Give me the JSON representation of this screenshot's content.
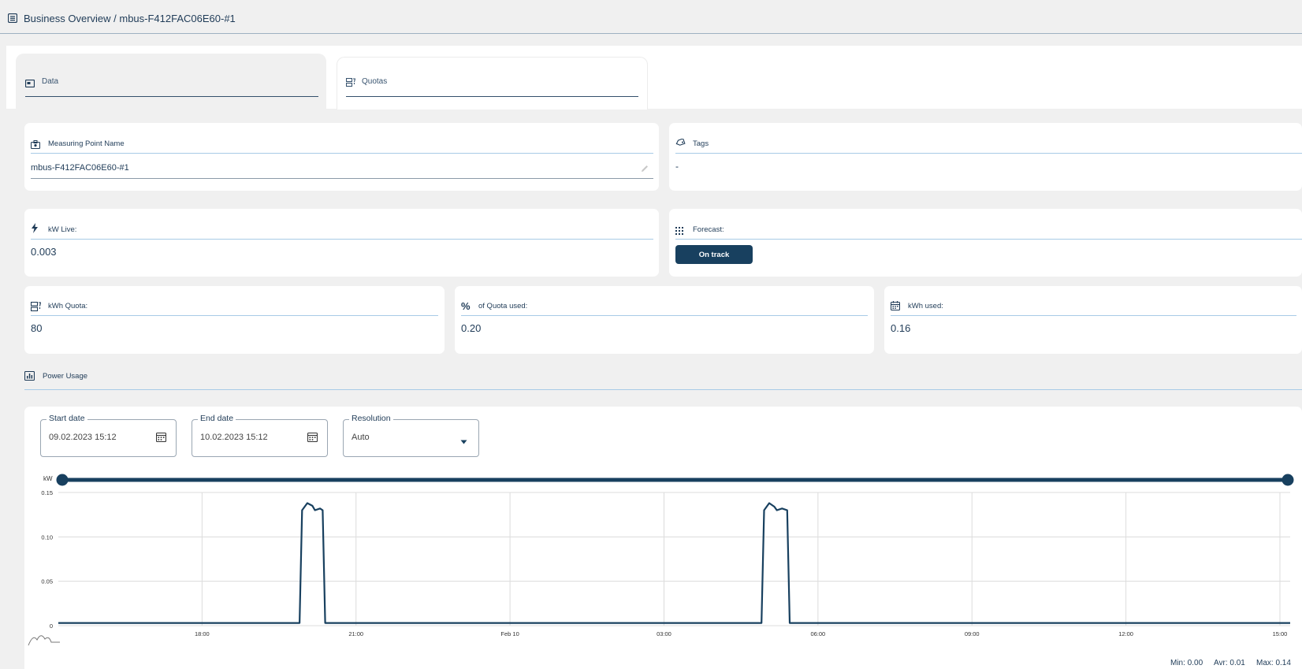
{
  "header": {
    "title": "Business Overview / mbus-F412FAC06E60-#1"
  },
  "tabs": [
    {
      "label": "Data",
      "icon": "card-icon",
      "active": true
    },
    {
      "label": "Quotas",
      "icon": "quota-icon",
      "active": false
    }
  ],
  "measuring_point": {
    "label": "Measuring Point Name",
    "value": "mbus-F412FAC06E60-#1"
  },
  "tags": {
    "label": "Tags",
    "value": "-"
  },
  "kw_live": {
    "label": "kW Live:",
    "value": "0.003"
  },
  "forecast": {
    "label": "Forecast:",
    "button": "On track"
  },
  "kwh_quota": {
    "label": "kWh Quota:",
    "value": "80"
  },
  "quota_used": {
    "label": "of Quota used:",
    "symbol": "%",
    "value": "0.20"
  },
  "kwh_used": {
    "label": "kWh used:",
    "value": "0.16"
  },
  "power_usage": {
    "label": "Power Usage"
  },
  "filters": {
    "start_date": {
      "legend": "Start date",
      "value": "09.02.2023 15:12"
    },
    "end_date": {
      "legend": "End date",
      "value": "10.02.2023 15:12"
    },
    "resolution": {
      "legend": "Resolution",
      "value": "Auto"
    }
  },
  "stats": {
    "min": "Min: 0.00",
    "avg": "Avr: 0.01",
    "max": "Max: 0.14"
  },
  "colors": {
    "primary": "#18405f",
    "rule": "#a8cbe6",
    "background": "#f0f0f0"
  },
  "chart_data": {
    "type": "line",
    "ylabel": "kW",
    "ylim": [
      0,
      0.15
    ],
    "yticks": [
      {
        "v": 0,
        "label": "0"
      },
      {
        "v": 0.05,
        "label": "0.05"
      },
      {
        "v": 0.1,
        "label": "0.10"
      },
      {
        "v": 0.15,
        "label": "0.15"
      }
    ],
    "xlim": [
      15.2,
      39.2
    ],
    "xticks": [
      {
        "h": 18,
        "label": "18:00"
      },
      {
        "h": 21,
        "label": "21:00"
      },
      {
        "h": 24,
        "label": "Feb 10"
      },
      {
        "h": 27,
        "label": "03:00"
      },
      {
        "h": 30,
        "label": "06:00"
      },
      {
        "h": 33,
        "label": "09:00"
      },
      {
        "h": 36,
        "label": "12:00"
      },
      {
        "h": 39,
        "label": "15:00"
      }
    ],
    "series": [
      {
        "points": [
          [
            15.2,
            0.003
          ],
          [
            19.9,
            0.003
          ],
          [
            19.95,
            0.13
          ],
          [
            20.05,
            0.138
          ],
          [
            20.15,
            0.135
          ],
          [
            20.2,
            0.13
          ],
          [
            20.3,
            0.132
          ],
          [
            20.35,
            0.13
          ],
          [
            20.4,
            0.003
          ],
          [
            28.9,
            0.003
          ],
          [
            28.95,
            0.13
          ],
          [
            29.05,
            0.138
          ],
          [
            29.15,
            0.134
          ],
          [
            29.2,
            0.13
          ],
          [
            29.3,
            0.132
          ],
          [
            29.4,
            0.13
          ],
          [
            29.45,
            0.003
          ],
          [
            39.2,
            0.003
          ]
        ]
      }
    ]
  }
}
